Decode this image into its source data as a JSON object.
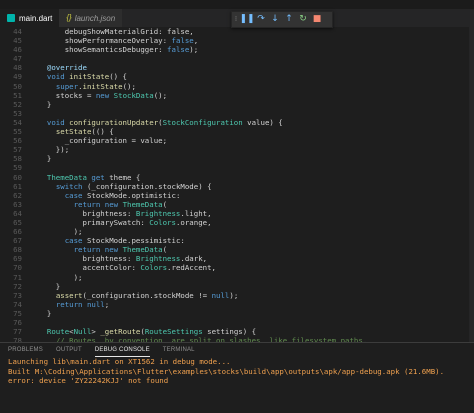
{
  "tabs": [
    {
      "label": "main.dart",
      "icon": "dart-icon",
      "active": true
    },
    {
      "label": "launch.json",
      "icon": "json-icon",
      "active": false
    }
  ],
  "debug_toolbar": [
    {
      "name": "drag-grip-icon",
      "glyph": "⁞",
      "color": "#7a7a7a"
    },
    {
      "name": "pause-icon",
      "glyph": "❚❚",
      "color": "#75beff"
    },
    {
      "name": "step-over-icon",
      "glyph": "↷",
      "color": "#75beff"
    },
    {
      "name": "step-into-icon",
      "glyph": "↓",
      "color": "#75beff"
    },
    {
      "name": "step-out-icon",
      "glyph": "↑",
      "color": "#75beff"
    },
    {
      "name": "restart-icon",
      "glyph": "↻",
      "color": "#89d185"
    },
    {
      "name": "stop-icon",
      "glyph": "■",
      "color": "#f48771"
    }
  ],
  "code_lines": [
    {
      "n": "44",
      "t": [
        [
          "      ",
          "p"
        ],
        [
          "debugShowMaterialGrid: false,",
          "p"
        ]
      ]
    },
    {
      "n": "45",
      "t": [
        [
          "      showPerformanceOverlay: ",
          "p"
        ],
        [
          "false",
          "k"
        ],
        [
          ",",
          "p"
        ]
      ]
    },
    {
      "n": "46",
      "t": [
        [
          "      showSemanticsDebugger: ",
          "p"
        ],
        [
          "false",
          "k"
        ],
        [
          ");",
          "p"
        ]
      ]
    },
    {
      "n": "47",
      "t": [
        [
          "  ",
          "p"
        ]
      ]
    },
    {
      "n": "48",
      "t": [
        [
          "  ",
          "p"
        ],
        [
          "@override",
          "i"
        ]
      ]
    },
    {
      "n": "49",
      "t": [
        [
          "  ",
          "p"
        ],
        [
          "void ",
          "k"
        ],
        [
          "initState",
          "f"
        ],
        [
          "() {",
          "p"
        ]
      ]
    },
    {
      "n": "50",
      "t": [
        [
          "    ",
          "p"
        ],
        [
          "super",
          "k"
        ],
        [
          ".",
          "p"
        ],
        [
          "initState",
          "f"
        ],
        [
          "();",
          "p"
        ]
      ]
    },
    {
      "n": "51",
      "t": [
        [
          "    stocks = ",
          "p"
        ],
        [
          "new ",
          "k"
        ],
        [
          "StockData",
          "t"
        ],
        [
          "();",
          "p"
        ]
      ]
    },
    {
      "n": "52",
      "t": [
        [
          "  }",
          "p"
        ]
      ]
    },
    {
      "n": "53",
      "t": [
        [
          "",
          "p"
        ]
      ]
    },
    {
      "n": "54",
      "t": [
        [
          "  ",
          "p"
        ],
        [
          "void ",
          "k"
        ],
        [
          "configurationUpdater",
          "f"
        ],
        [
          "(",
          "p"
        ],
        [
          "StockConfiguration",
          "t"
        ],
        [
          " value) {",
          "p"
        ]
      ]
    },
    {
      "n": "55",
      "t": [
        [
          "    ",
          "p"
        ],
        [
          "setState",
          "f"
        ],
        [
          "(() {",
          "p"
        ]
      ]
    },
    {
      "n": "56",
      "t": [
        [
          "      _configuration = value;",
          "p"
        ]
      ]
    },
    {
      "n": "57",
      "t": [
        [
          "    });",
          "p"
        ]
      ]
    },
    {
      "n": "58",
      "t": [
        [
          "  }",
          "p"
        ]
      ]
    },
    {
      "n": "59",
      "t": [
        [
          "",
          "p"
        ]
      ]
    },
    {
      "n": "60",
      "t": [
        [
          "  ",
          "p"
        ],
        [
          "ThemeData",
          "t"
        ],
        [
          " get ",
          "k"
        ],
        [
          "theme {",
          "p"
        ]
      ]
    },
    {
      "n": "61",
      "t": [
        [
          "    ",
          "p"
        ],
        [
          "switch",
          "k"
        ],
        [
          " (_configuration.stockMode) {",
          "p"
        ]
      ]
    },
    {
      "n": "62",
      "t": [
        [
          "      ",
          "p"
        ],
        [
          "case",
          "k"
        ],
        [
          " StockMode.optimistic:",
          "p"
        ]
      ]
    },
    {
      "n": "63",
      "t": [
        [
          "        ",
          "p"
        ],
        [
          "return new ",
          "k"
        ],
        [
          "ThemeData",
          "t"
        ],
        [
          "(",
          "p"
        ]
      ]
    },
    {
      "n": "64",
      "t": [
        [
          "          brightness: ",
          "p"
        ],
        [
          "Brightness",
          "t"
        ],
        [
          ".light,",
          "p"
        ]
      ]
    },
    {
      "n": "65",
      "t": [
        [
          "          primarySwatch: ",
          "p"
        ],
        [
          "Colors",
          "t"
        ],
        [
          ".orange,",
          "p"
        ]
      ]
    },
    {
      "n": "66",
      "t": [
        [
          "        );",
          "p"
        ]
      ]
    },
    {
      "n": "67",
      "t": [
        [
          "      ",
          "p"
        ],
        [
          "case",
          "k"
        ],
        [
          " StockMode.pessimistic:",
          "p"
        ]
      ]
    },
    {
      "n": "68",
      "t": [
        [
          "        ",
          "p"
        ],
        [
          "return new ",
          "k"
        ],
        [
          "ThemeData",
          "t"
        ],
        [
          "(",
          "p"
        ]
      ]
    },
    {
      "n": "69",
      "t": [
        [
          "          brightness: ",
          "p"
        ],
        [
          "Brightness",
          "t"
        ],
        [
          ".dark,",
          "p"
        ]
      ]
    },
    {
      "n": "70",
      "t": [
        [
          "          accentColor: ",
          "p"
        ],
        [
          "Colors",
          "t"
        ],
        [
          ".redAccent,",
          "p"
        ]
      ]
    },
    {
      "n": "71",
      "t": [
        [
          "        );",
          "p"
        ]
      ]
    },
    {
      "n": "72",
      "t": [
        [
          "    }",
          "p"
        ]
      ]
    },
    {
      "n": "73",
      "t": [
        [
          "    ",
          "p"
        ],
        [
          "assert",
          "f"
        ],
        [
          "(_configuration.stockMode != ",
          "p"
        ],
        [
          "null",
          "k"
        ],
        [
          ");",
          "p"
        ]
      ]
    },
    {
      "n": "74",
      "t": [
        [
          "    ",
          "p"
        ],
        [
          "return null",
          "k"
        ],
        [
          ";",
          "p"
        ]
      ]
    },
    {
      "n": "75",
      "t": [
        [
          "  }",
          "p"
        ]
      ]
    },
    {
      "n": "76",
      "t": [
        [
          "",
          "p"
        ]
      ]
    },
    {
      "n": "77",
      "t": [
        [
          "  ",
          "p"
        ],
        [
          "Route",
          "t"
        ],
        [
          "<",
          "p"
        ],
        [
          "Null",
          "t"
        ],
        [
          "> ",
          "p"
        ],
        [
          "_getRoute",
          "f"
        ],
        [
          "(",
          "p"
        ],
        [
          "RouteSettings",
          "t"
        ],
        [
          " settings) {",
          "p"
        ]
      ]
    },
    {
      "n": "78",
      "t": [
        [
          "    ",
          "p"
        ],
        [
          "// Routes, by convention, are split on slashes, like filesystem paths.",
          "c"
        ]
      ]
    }
  ],
  "panel": {
    "tabs": [
      "PROBLEMS",
      "OUTPUT",
      "DEBUG CONSOLE",
      "TERMINAL"
    ],
    "active_tab": "DEBUG CONSOLE",
    "console_lines": [
      "Launching lib\\main.dart on XT1562 in debug mode...",
      "Built M:\\Coding\\Applications\\Flutter\\examples\\stocks\\build\\app\\outputs\\apk/app-debug.apk (21.6MB).",
      "error: device 'ZY22242KJJ' not found"
    ]
  }
}
